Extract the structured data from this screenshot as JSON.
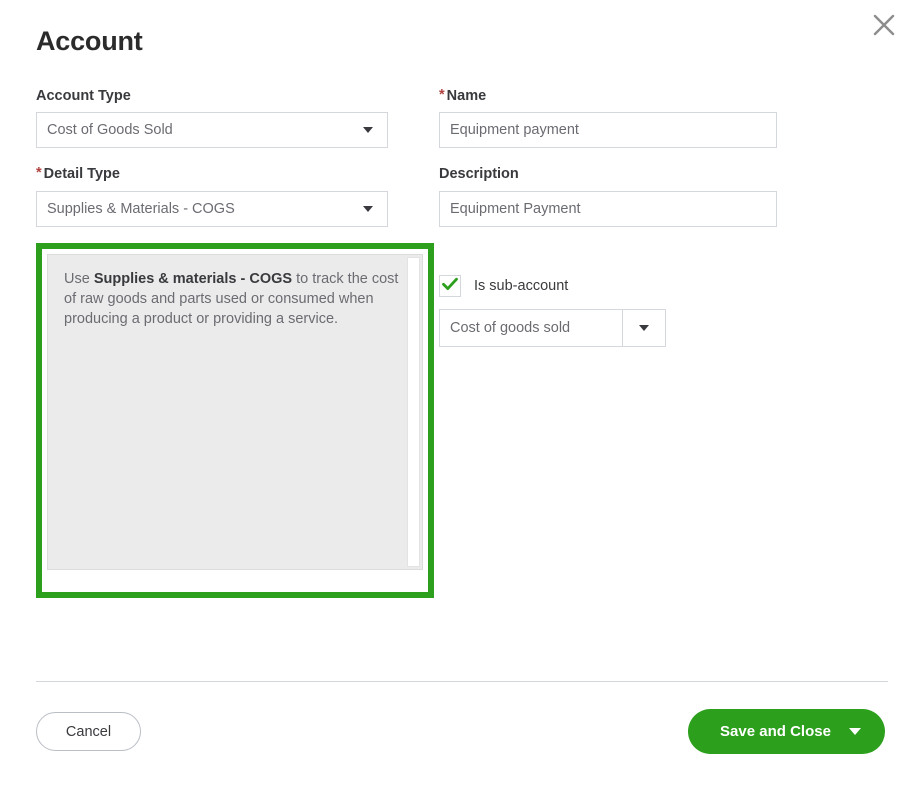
{
  "dialog": {
    "title": "Account",
    "close_icon": "close-icon"
  },
  "left_column": {
    "account_type": {
      "label": "Account Type",
      "required": false,
      "value": "Cost of Goods Sold"
    },
    "detail_type": {
      "label": "Detail Type",
      "required": true,
      "required_marker": "*",
      "value": "Supplies & Materials - COGS"
    }
  },
  "help_panel": {
    "text_before": "Use ",
    "text_bold": "Supplies & materials - COGS",
    "text_after": " to track the cost of raw goods and parts used or consumed when producing a product or providing a service."
  },
  "right_column": {
    "name": {
      "label": "Name",
      "required": true,
      "required_marker": "*",
      "value": "Equipment payment"
    },
    "description": {
      "label": "Description",
      "required": false,
      "value": "Equipment Payment"
    },
    "sub_account": {
      "checkbox_label": "Is sub-account",
      "checked": true,
      "parent_value": "Cost of goods sold"
    }
  },
  "footer": {
    "cancel_label": "Cancel",
    "save_label": "Save and Close"
  },
  "colors": {
    "brand_green": "#2ca01c",
    "required_red": "#b0413e",
    "border_gray": "#d4d7dc",
    "panel_gray": "#ebebeb",
    "text_dark": "#393a3d",
    "text_muted": "#6b6c72"
  }
}
